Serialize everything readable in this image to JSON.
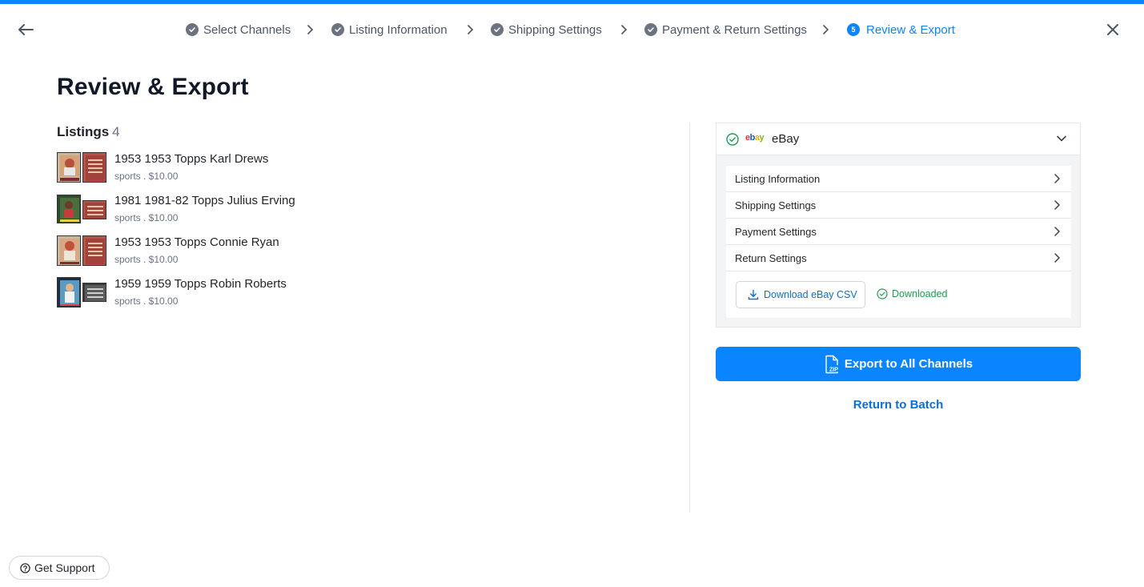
{
  "stepper": {
    "steps": [
      {
        "label": "Select Channels",
        "status": "done"
      },
      {
        "label": "Listing Information",
        "status": "done"
      },
      {
        "label": "Shipping Settings",
        "status": "done"
      },
      {
        "label": "Payment & Return Settings",
        "status": "done"
      },
      {
        "label": "Review & Export",
        "status": "active",
        "number": "5"
      }
    ]
  },
  "page": {
    "title": "Review & Export"
  },
  "listings": {
    "heading": "Listings",
    "count": "4",
    "items": [
      {
        "name": "1953 1953 Topps Karl Drews",
        "meta": "sports . $10.00"
      },
      {
        "name": "1981 1981-82 Topps Julius Erving",
        "meta": "sports . $10.00"
      },
      {
        "name": "1953 1953 Topps Connie Ryan",
        "meta": "sports . $10.00"
      },
      {
        "name": "1959 1959 Topps Robin Roberts",
        "meta": "sports . $10.00"
      }
    ]
  },
  "channel": {
    "logo_text": "ebay",
    "name": "eBay",
    "settings": [
      {
        "label": "Listing Information"
      },
      {
        "label": "Shipping Settings"
      },
      {
        "label": "Payment Settings"
      },
      {
        "label": "Return Settings"
      }
    ],
    "download_label": "Download eBay CSV",
    "download_status": "Downloaded"
  },
  "actions": {
    "export_label": "Export to All Channels",
    "return_label": "Return to Batch"
  },
  "support": {
    "label": "Get Support"
  },
  "colors": {
    "accent": "#0a84ff",
    "success": "#1f9d55",
    "link": "#0a6fd6"
  }
}
